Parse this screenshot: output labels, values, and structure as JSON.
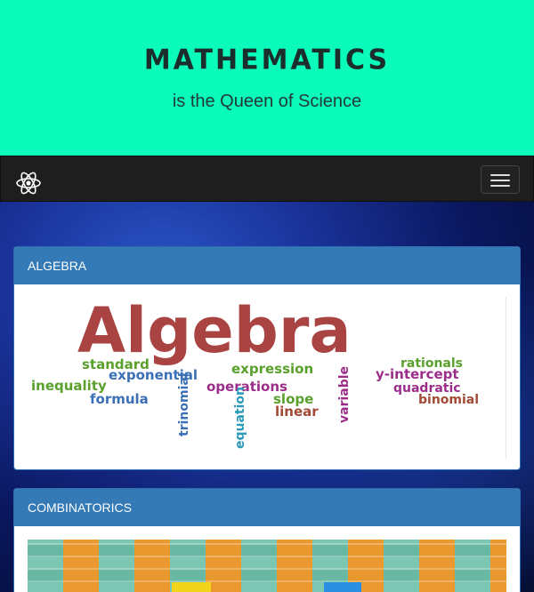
{
  "header": {
    "title": "MATHEMATICS",
    "subtitle": "is the Queen of Science"
  },
  "navbar": {
    "brand_icon": "atom-icon",
    "toggle_icon": "hamburger-menu-icon"
  },
  "panels": [
    {
      "heading": "ALGEBRA",
      "image": {
        "type": "word-cloud",
        "main_word": "Algebra",
        "words": [
          "standard",
          "expression",
          "rationals",
          "exponential",
          "y-intercept",
          "inequality",
          "operations",
          "quadratic",
          "formula",
          "slope",
          "binomial",
          "linear",
          "trinomial",
          "equation",
          "variable"
        ]
      }
    },
    {
      "heading": "COMBINATORICS",
      "image": {
        "type": "tile-grid"
      }
    }
  ],
  "colors": {
    "hero_bg": "#0afbba",
    "navbar_bg": "#1e1e1e",
    "panel_heading_bg": "#337ab7",
    "word_main": "#a94442",
    "word_green": "#5aa02c",
    "word_blue": "#3b6fb6",
    "word_purple": "#9b2d8a",
    "word_brown": "#a24a36",
    "word_teal": "#2a9ab8"
  }
}
